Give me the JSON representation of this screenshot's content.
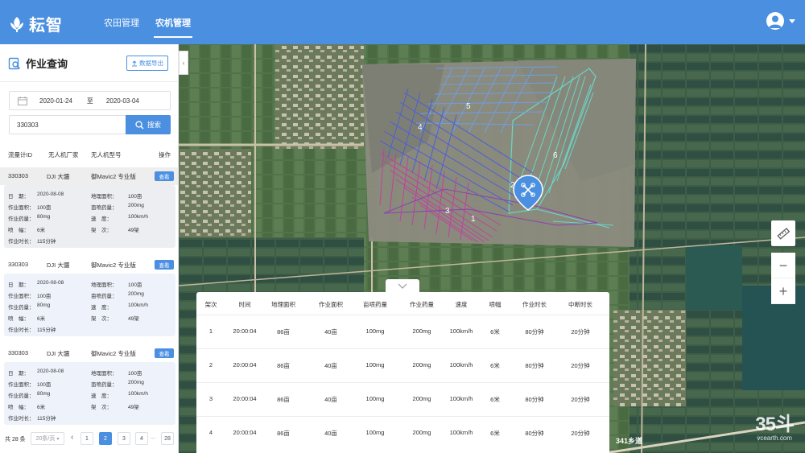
{
  "app": {
    "logo_text": "耘智",
    "nav": [
      {
        "label": "农田管理",
        "active": false
      },
      {
        "label": "农机管理",
        "active": true
      }
    ]
  },
  "sidebar": {
    "title": "作业查询",
    "export_label": "数据导出",
    "date_from": "2020-01-24",
    "date_sep": "至",
    "date_to": "2020-03-04",
    "search_value": "330303",
    "search_label": "搜索",
    "columns": [
      "流量计ID",
      "无人机厂家",
      "无人机型号",
      "操作"
    ],
    "records": [
      {
        "id": "330303",
        "maker": "DJI 大疆",
        "model": "御Mavic2 专业版",
        "action": "查看",
        "details": {
          "date_k": "日　期：",
          "date_v": "2020-08-08",
          "area_k": "作业面积：",
          "area_v": "100亩",
          "dose_k": "作业药量：",
          "dose_v": "80mg",
          "width_k": "喷　幅：",
          "width_v": "6米",
          "dur_k": "作业时长：",
          "dur_v": "115分钟",
          "land_k": "地理面积：",
          "land_v": "100亩",
          "mu_k": "亩喷药量：",
          "mu_v": "200mg",
          "speed_k": "速　度：",
          "speed_v": "100km/h",
          "sorties_k": "架　次：",
          "sorties_v": "49架"
        }
      },
      {
        "id": "330303",
        "maker": "DJI 大疆",
        "model": "御Mavic2 专业版",
        "action": "查看",
        "details": {
          "date_k": "日　期：",
          "date_v": "2020-08-08",
          "area_k": "作业面积：",
          "area_v": "100亩",
          "dose_k": "作业药量：",
          "dose_v": "80mg",
          "width_k": "喷　幅：",
          "width_v": "6米",
          "dur_k": "作业时长：",
          "dur_v": "115分钟",
          "land_k": "地理面积：",
          "land_v": "100亩",
          "mu_k": "亩喷药量：",
          "mu_v": "200mg",
          "speed_k": "速　度：",
          "speed_v": "100km/h",
          "sorties_k": "架　次：",
          "sorties_v": "49架"
        }
      },
      {
        "id": "330303",
        "maker": "DJI 大疆",
        "model": "御Mavic2 专业版",
        "action": "查看",
        "details": {
          "date_k": "日　期：",
          "date_v": "2020-08-08",
          "area_k": "作业面积：",
          "area_v": "100亩",
          "dose_k": "作业药量：",
          "dose_v": "80mg",
          "width_k": "喷　幅：",
          "width_v": "6米",
          "dur_k": "作业时长：",
          "dur_v": "115分钟",
          "land_k": "地理面积：",
          "land_v": "100亩",
          "mu_k": "亩喷药量：",
          "mu_v": "200mg",
          "speed_k": "速　度：",
          "speed_v": "100km/h",
          "sorties_k": "架　次：",
          "sorties_v": "49架"
        }
      }
    ],
    "pager": {
      "total": "共 28 条",
      "page_size": "20条/页",
      "pages": [
        "1",
        "2",
        "3",
        "4",
        "...",
        "28"
      ],
      "current": "2",
      "prev": "‹"
    }
  },
  "map": {
    "zone_labels": [
      "1",
      "2",
      "3",
      "4",
      "5",
      "6"
    ],
    "road_label": "341乡道",
    "watermark_big": "35斗",
    "watermark_small": "vcearth.com",
    "tools": [
      "ruler-icon",
      "zoom-out-icon",
      "zoom-in-icon"
    ]
  },
  "sortie_table": {
    "columns": [
      "架次",
      "时间",
      "地理面积",
      "作业面积",
      "亩喷药量",
      "作业药量",
      "速度",
      "喷幅",
      "作业时长",
      "中断时长"
    ],
    "rows": [
      [
        "1",
        "20:00:04",
        "86亩",
        "40亩",
        "100mg",
        "200mg",
        "100km/h",
        "6米",
        "80分钟",
        "20分钟"
      ],
      [
        "2",
        "20:00:04",
        "86亩",
        "40亩",
        "100mg",
        "200mg",
        "100km/h",
        "6米",
        "80分钟",
        "20分钟"
      ],
      [
        "3",
        "20:00:04",
        "86亩",
        "40亩",
        "100mg",
        "200mg",
        "100km/h",
        "6米",
        "80分钟",
        "20分钟"
      ],
      [
        "4",
        "20:00:04",
        "86亩",
        "40亩",
        "100mg",
        "200mg",
        "100km/h",
        "6米",
        "80分钟",
        "20分钟"
      ]
    ]
  },
  "colors": {
    "brand": "#4a8fe0",
    "zone_magenta": "#c2409e",
    "zone_blue": "#4c5fd6",
    "zone_sky": "#6f9de6",
    "zone_cyan": "#6ad7c8"
  }
}
